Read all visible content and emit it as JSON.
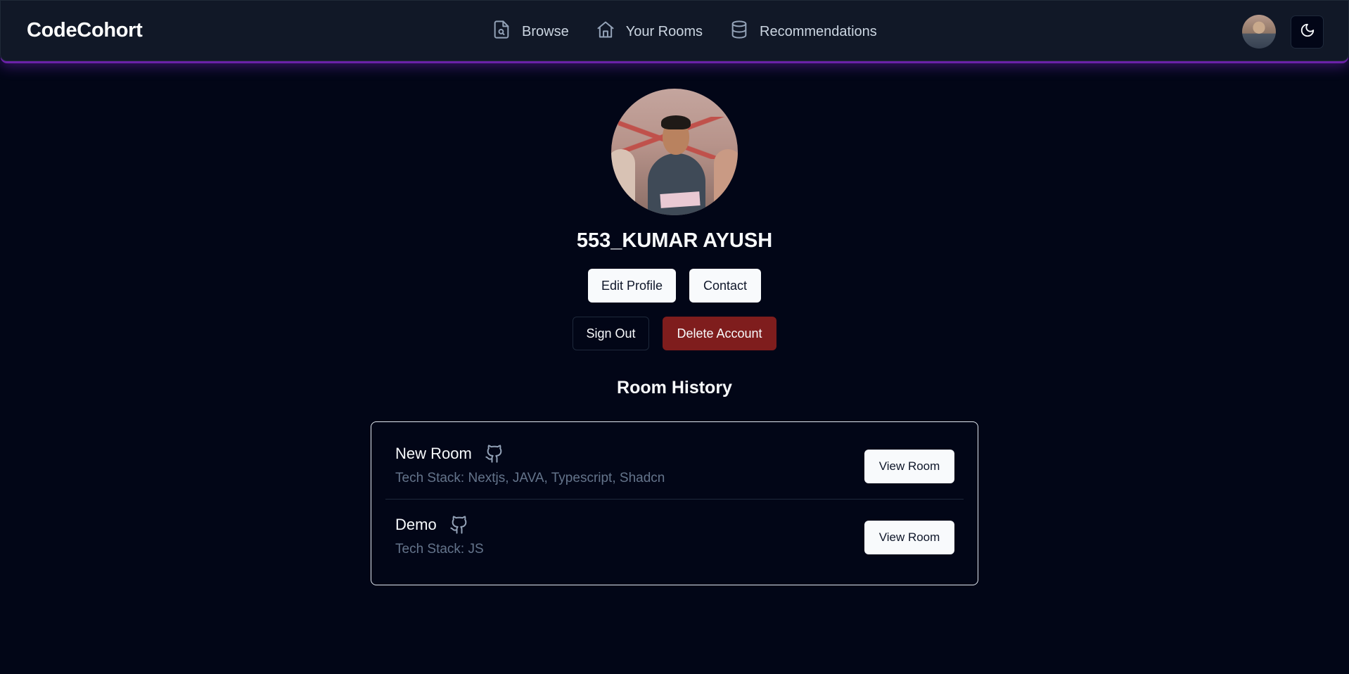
{
  "header": {
    "brand": "CodeCohort",
    "nav": [
      {
        "label": "Browse",
        "icon": "file-search-icon"
      },
      {
        "label": "Your Rooms",
        "icon": "home-icon"
      },
      {
        "label": "Recommendations",
        "icon": "database-icon"
      }
    ],
    "avatar_icon": "avatar",
    "theme_toggle_icon": "moon-icon"
  },
  "profile": {
    "name": "553_KUMAR AYUSH",
    "edit_label": "Edit Profile",
    "contact_label": "Contact",
    "signout_label": "Sign Out",
    "delete_label": "Delete Account"
  },
  "room_history": {
    "title": "Room History",
    "rooms": [
      {
        "name": "New Room",
        "tech_stack": "Tech Stack: Nextjs, JAVA, Typescript, Shadcn",
        "action_label": "View Room",
        "icon": "github-icon"
      },
      {
        "name": "Demo",
        "tech_stack": "Tech Stack: JS",
        "action_label": "View Room",
        "icon": "github-icon"
      }
    ]
  },
  "colors": {
    "background": "#020617",
    "nav_background": "#111827",
    "accent_glow": "#6b21a8",
    "danger": "#7f1d1d",
    "muted_text": "#64748b"
  }
}
